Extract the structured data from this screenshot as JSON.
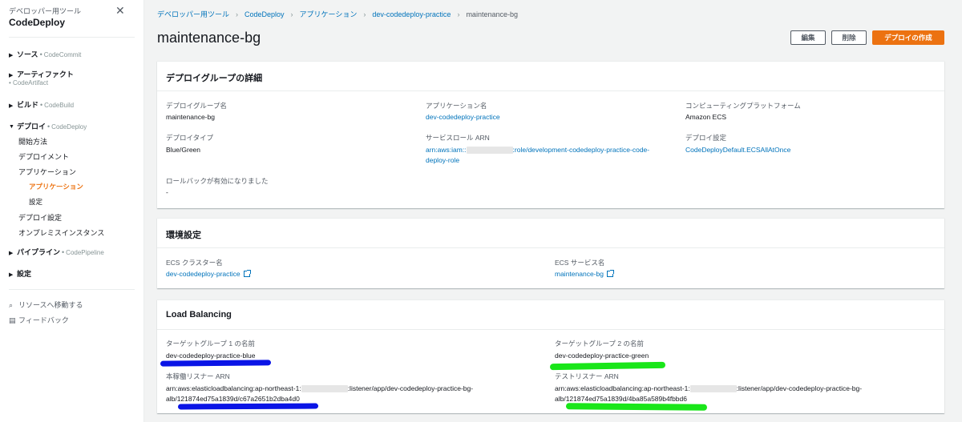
{
  "sidebar": {
    "subtitle": "デベロッパー用ツール",
    "title": "CodeDeploy",
    "close_icon": "close-icon",
    "groups": [
      {
        "name": "ソース",
        "service": "CodeCommit"
      },
      {
        "name": "アーティファクト",
        "service": "CodeArtifact"
      },
      {
        "name": "ビルド",
        "service": "CodeBuild"
      },
      {
        "name": "デプロイ",
        "service": "CodeDeploy"
      },
      {
        "name": "パイプライン",
        "service": "CodePipeline"
      },
      {
        "name": "設定",
        "service": ""
      }
    ],
    "deploy_items": [
      "開始方法",
      "デプロイメント",
      "アプリケーション",
      "アプリケーション",
      "設定",
      "デプロイ設定",
      "オンプレミスインスタンス"
    ],
    "footer": {
      "search": "リソースへ移動する",
      "feedback": "フィードバック"
    }
  },
  "breadcrumb": [
    "デベロッパー用ツール",
    "CodeDeploy",
    "アプリケーション",
    "dev-codedeploy-practice",
    "maintenance-bg"
  ],
  "page_title": "maintenance-bg",
  "buttons": {
    "edit": "編集",
    "delete": "削除",
    "create_deployment": "デプロイの作成"
  },
  "details": {
    "heading": "デプロイグループの詳細",
    "group_name_label": "デプロイグループ名",
    "group_name": "maintenance-bg",
    "app_name_label": "アプリケーション名",
    "app_name": "dev-codedeploy-practice",
    "platform_label": "コンピューティングプラットフォーム",
    "platform": "Amazon ECS",
    "deploy_type_label": "デプロイタイプ",
    "deploy_type": "Blue/Green",
    "service_role_label": "サービスロール ARN",
    "service_role_prefix": "arn:aws:iam::",
    "service_role_suffix": ":role/development-codedeploy-practice-code-",
    "service_role_line2": "deploy-role",
    "deploy_config_label": "デプロイ設定",
    "deploy_config": "CodeDeployDefault.ECSAllAtOnce",
    "rollback_label": "ロールバックが有効になりました",
    "rollback": "-"
  },
  "environment": {
    "heading": "環境設定",
    "cluster_label": "ECS クラスター名",
    "cluster": "dev-codedeploy-practice",
    "service_label": "ECS サービス名",
    "service": "maintenance-bg"
  },
  "load_balancing": {
    "heading": "Load Balancing",
    "tg1_label": "ターゲットグループ 1 の名前",
    "tg1": "dev-codedeploy-practice-blue",
    "tg2_label": "ターゲットグループ 2 の名前",
    "tg2": "dev-codedeploy-practice-green",
    "prod_listener_label": "本稼働リスナー ARN",
    "prod_listener_prefix": "arn:aws:elasticloadbalancing:ap-northeast-1:",
    "prod_listener_suffix": ":listener/app/dev-codedeploy-practice-bg-",
    "prod_listener_line2": "alb/121874ed75a1839d/c67a2651b2dba4d0",
    "test_listener_label": "テストリスナー ARN",
    "test_listener_prefix": "arn:aws:elasticloadbalancing:ap-northeast-1:",
    "test_listener_suffix": ":listener/app/dev-codedeploy-practice-bg-",
    "test_listener_line2": "alb/121874ed75a1839d/4ba85a589b4fbbd6"
  },
  "colors": {
    "accent": "#ec7211",
    "link": "#0073bb",
    "marker_blue": "#0a14e6",
    "marker_green": "#19e619"
  }
}
